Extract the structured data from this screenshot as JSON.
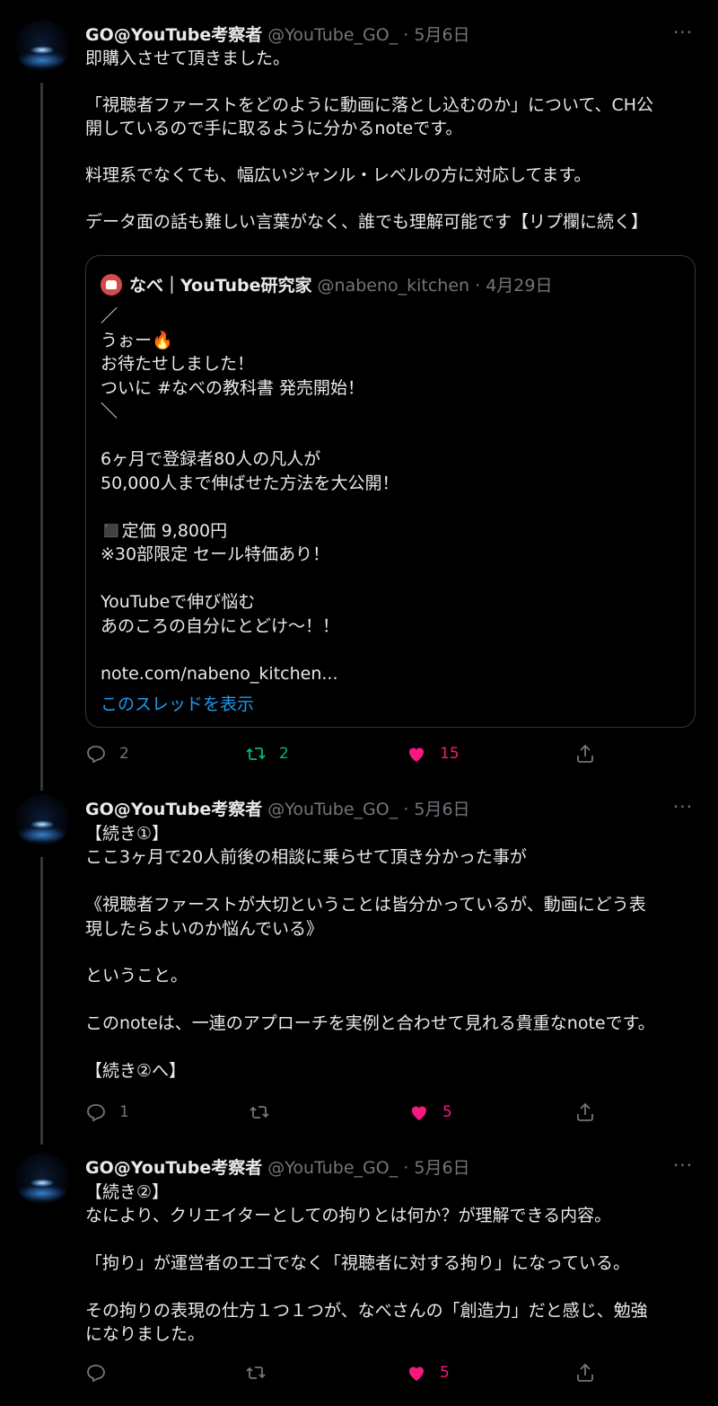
{
  "tweets": [
    {
      "name": "GO@YouTube考察者",
      "handle": "@YouTube_GO_",
      "sep": " · ",
      "date": "5月6日",
      "more": "···",
      "text": "即購入させて頂きました。\n\n「視聴者ファーストをどのように動画に落とし込むのか」について、CH公\n開しているので手に取るように分かるnoteです。\n\n料理系でなくても、幅広いジャンル・レベルの方に対応してます。\n\nデータ面の話も難しい言葉がなく、誰でも理解可能です【リプ欄に続く】",
      "reply_count": "2",
      "retweet_count": "2",
      "like_count": "15"
    },
    {
      "name": "GO@YouTube考察者",
      "handle": "@YouTube_GO_",
      "sep": " · ",
      "date": "5月6日",
      "more": "···",
      "text": "【続き①】\nここ3ヶ月で20人前後の相談に乗らせて頂き分かった事が\n\n《視聴者ファーストが大切ということは皆分かっているが、動画にどう表\n現したらよいのか悩んでいる》\n\nということ。\n\nこのnoteは、一連のアプローチを実例と合わせて見れる貴重なnoteです。\n\n【続き②へ】",
      "reply_count": "1",
      "retweet_count": "",
      "like_count": "5"
    },
    {
      "name": "GO@YouTube考察者",
      "handle": "@YouTube_GO_",
      "sep": " · ",
      "date": "5月6日",
      "more": "···",
      "text": "【続き②】\nなにより、クリエイターとしての拘りとは何か？が理解できる内容。\n\n「拘り」が運営者のエゴでなく「視聴者に対する拘り」になっている。\n\nその拘りの表現の仕方１つ１つが、なべさんの「創造力」だと感じ、勉強\nになりました。",
      "reply_count": "",
      "retweet_count": "",
      "like_count": "5"
    }
  ],
  "quote": {
    "name": "なべ｜YouTube研究家",
    "handle": "@nabeno_kitchen",
    "sep": " · ",
    "date": "4月29日",
    "text": "／\n うぉー🔥\n お待たせしました！\n ついに #なべの教科書 発売開始！\n＼\n\n6ヶ月で登録者80人の凡人が\n50,000人まで伸ばせた方法を大公開！\n\n◼️定価 9,800円\n※30部限定 セール特価あり！\n\nYouTubeで伸び悩む\nあのころの自分にとどけ〜！！\n\nnote.com/nabeno_kitchen...",
    "show_thread": "このスレッドを表示"
  },
  "colors": {
    "background": "#000000",
    "text": "#e7e9ea",
    "secondary": "#71767b",
    "retweet_green": "#00ba7c",
    "like_pink": "#f91880",
    "link_blue": "#1d9bf0"
  },
  "icons": [
    "reply-icon",
    "retweet-icon",
    "like-icon",
    "share-icon",
    "more-icon"
  ]
}
